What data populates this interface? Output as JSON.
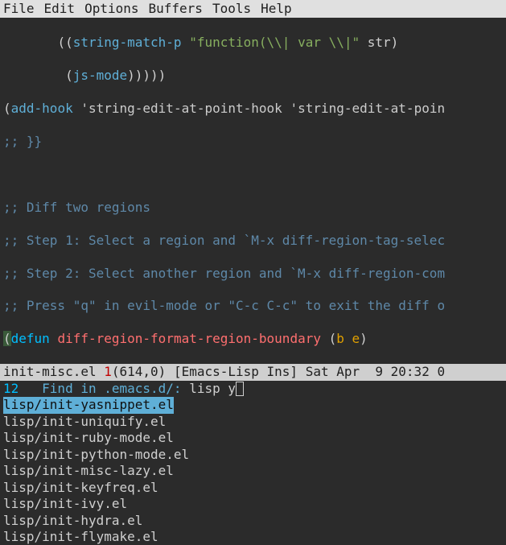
{
  "menubar": [
    "File",
    "Edit",
    "Options",
    "Buffers",
    "Tools",
    "Help"
  ],
  "code": {
    "line1": {
      "indent": "       ",
      "p1": "((",
      "fn": "string-match-p",
      "sp": " ",
      "str": "\"function(\\\\| var \\\\|\"",
      "sp2": " ",
      "arg": "str",
      "p2": ")"
    },
    "line2": {
      "indent": "        ",
      "p1": "(",
      "fn": "js-mode",
      "p2": ")))))"
    },
    "line3": {
      "p1": "(",
      "fn": "add-hook",
      "sp": " ",
      "lit1": "'string-edit-at-point-hook",
      "sp2": " ",
      "lit2": "'string-edit-at-poin"
    },
    "line4": ";; }}",
    "line5": "",
    "line6": ";; Diff two regions",
    "line7": ";; Step 1: Select a region and `M-x diff-region-tag-selec",
    "line8": ";; Step 2: Select another region and `M-x diff-region-com",
    "line9": ";; Press \"q\" in evil-mode or \"C-c C-c\" to exit the diff o",
    "line10": {
      "p1": "(",
      "kw": "defun",
      "sp": " ",
      "name": "diff-region-format-region-boundary",
      "sp2": " ",
      "p2": "(",
      "a1": "b",
      "sp3": " ",
      "a2": "e",
      "p3": ")"
    }
  },
  "modeline": {
    "buf": "init-misc.el ",
    "mod": "1",
    "pos": "(614,0) [Emacs-Lisp Ins] Sat Apr  9 20:32 0"
  },
  "minibuf": {
    "count": "12",
    "prompt": "   Find in .emacs.d/: ",
    "input": "lisp y"
  },
  "candidates": [
    "lisp/init-yasnippet.el",
    "lisp/init-uniquify.el",
    "lisp/init-ruby-mode.el",
    "lisp/init-python-mode.el",
    "lisp/init-misc-lazy.el",
    "lisp/init-keyfreq.el",
    "lisp/init-ivy.el",
    "lisp/init-hydra.el",
    "lisp/init-flymake.el"
  ]
}
